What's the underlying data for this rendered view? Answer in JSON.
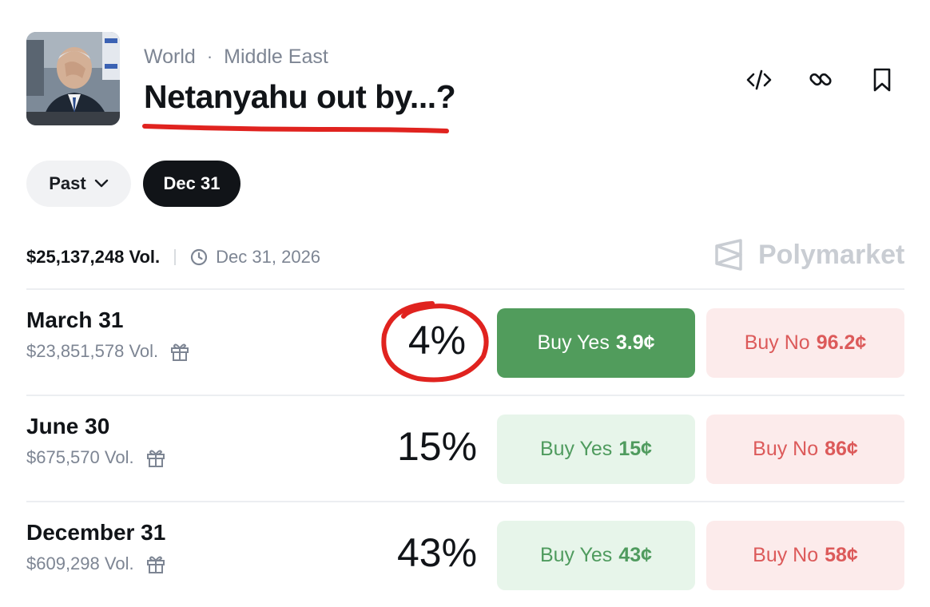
{
  "header": {
    "category": "World",
    "separator": "·",
    "subcategory": "Middle East",
    "title": "Netanyahu out by...?"
  },
  "icons": {
    "embed": "code-icon",
    "link": "link-icon",
    "bookmark": "bookmark-icon"
  },
  "filters": {
    "past_label": "Past",
    "selected_label": "Dec 31"
  },
  "summary": {
    "volume": "$25,137,248 Vol.",
    "end_date": "Dec 31, 2026",
    "brand": "Polymarket"
  },
  "outcomes": [
    {
      "name": "March 31",
      "volume": "$23,851,578 Vol.",
      "percent": "4%",
      "yes_label": "Buy Yes",
      "yes_price": "3.9¢",
      "no_label": "Buy No",
      "no_price": "96.2¢"
    },
    {
      "name": "June 30",
      "volume": "$675,570 Vol.",
      "percent": "15%",
      "yes_label": "Buy Yes",
      "yes_price": "15¢",
      "no_label": "Buy No",
      "no_price": "86¢"
    },
    {
      "name": "December 31",
      "volume": "$609,298 Vol.",
      "percent": "43%",
      "yes_label": "Buy Yes",
      "yes_price": "43¢",
      "no_label": "Buy No",
      "no_price": "58¢"
    }
  ],
  "colors": {
    "yes_active": "#519c5c",
    "yes_bg": "#e7f5ea",
    "yes_text": "#4f9b5e",
    "no_bg": "#fcebeb",
    "no_text": "#dc5a5a",
    "annotation_red": "#e0231f"
  }
}
